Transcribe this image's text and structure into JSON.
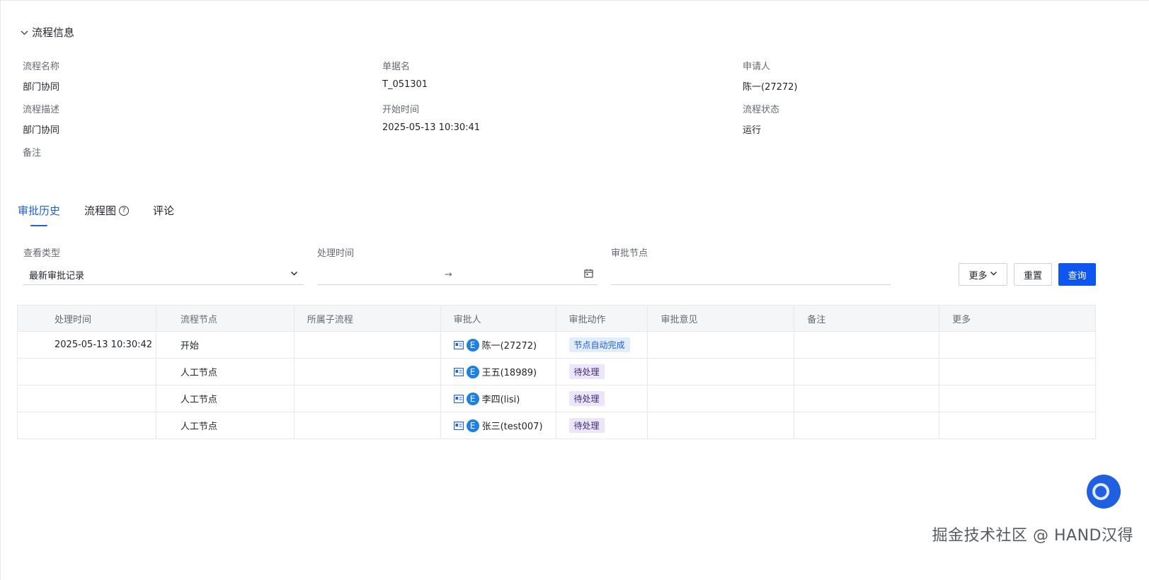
{
  "section": {
    "title": "流程信息"
  },
  "info": {
    "process_name": {
      "label": "流程名称",
      "value": "部门协同"
    },
    "doc_name": {
      "label": "单据名",
      "value": "T_051301"
    },
    "applicant": {
      "label": "申请人",
      "value": "陈一(27272)"
    },
    "process_desc": {
      "label": "流程描述",
      "value": "部门协同"
    },
    "start_time": {
      "label": "开始时间",
      "value": "2025-05-13 10:30:41"
    },
    "process_status": {
      "label": "流程状态",
      "value": "运行"
    },
    "remark": {
      "label": "备注",
      "value": ""
    }
  },
  "tabs": [
    {
      "label": "审批历史",
      "active": true
    },
    {
      "label": "流程图",
      "active": false
    },
    {
      "label": "评论",
      "active": false
    }
  ],
  "filters": {
    "view_type": {
      "label": "查看类型",
      "value": "最新审批记录"
    },
    "process_time": {
      "label": "处理时间",
      "separator": "→"
    },
    "node": {
      "label": "审批节点",
      "value": ""
    }
  },
  "buttons": {
    "more": "更多",
    "reset": "重置",
    "query": "查询"
  },
  "table": {
    "columns": [
      "处理时间",
      "流程节点",
      "所属子流程",
      "审批人",
      "审批动作",
      "审批意见",
      "备注",
      "更多"
    ],
    "rows": [
      {
        "time": "2025-05-13 10:30:42",
        "node": "开始",
        "subflow": "",
        "approver": "陈一(27272)",
        "avatar": "E",
        "action": "节点自动完成",
        "action_type": "auto",
        "opinion": "",
        "remark": "",
        "more": ""
      },
      {
        "time": "",
        "node": "人工节点",
        "subflow": "",
        "approver": "王五(18989)",
        "avatar": "E",
        "action": "待处理",
        "action_type": "pending",
        "opinion": "",
        "remark": "",
        "more": ""
      },
      {
        "time": "",
        "node": "人工节点",
        "subflow": "",
        "approver": "李四(lisi)",
        "avatar": "E",
        "action": "待处理",
        "action_type": "pending",
        "opinion": "",
        "remark": "",
        "more": ""
      },
      {
        "time": "",
        "node": "人工节点",
        "subflow": "",
        "approver": "张三(test007)",
        "avatar": "E",
        "action": "待处理",
        "action_type": "pending",
        "opinion": "",
        "remark": "",
        "more": ""
      }
    ]
  },
  "watermark": "掘金技术社区 @ HAND汉得",
  "colors": {
    "primary": "#0f56f0",
    "tab_active": "#1f5fe0",
    "auto_badge_bg": "#e1ecff",
    "pending_badge_bg": "#ece5fb"
  }
}
